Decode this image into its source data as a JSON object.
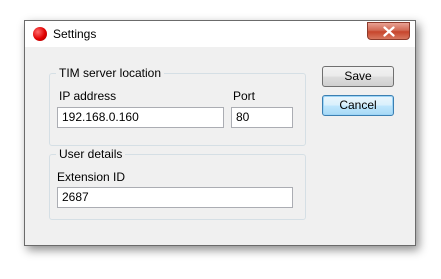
{
  "window": {
    "title": "Settings",
    "icon": "app-red-circle-icon"
  },
  "tim_server": {
    "legend": "TIM server location",
    "ip_label": "IP address",
    "ip_value": "192.168.0.160",
    "port_label": "Port",
    "port_value": "80"
  },
  "user_details": {
    "legend": "User details",
    "extension_label": "Extension ID",
    "extension_value": "2687"
  },
  "buttons": {
    "save": "Save",
    "cancel": "Cancel"
  },
  "colors": {
    "close_button": "#c7452c",
    "default_button_border": "#3c7fb1"
  }
}
